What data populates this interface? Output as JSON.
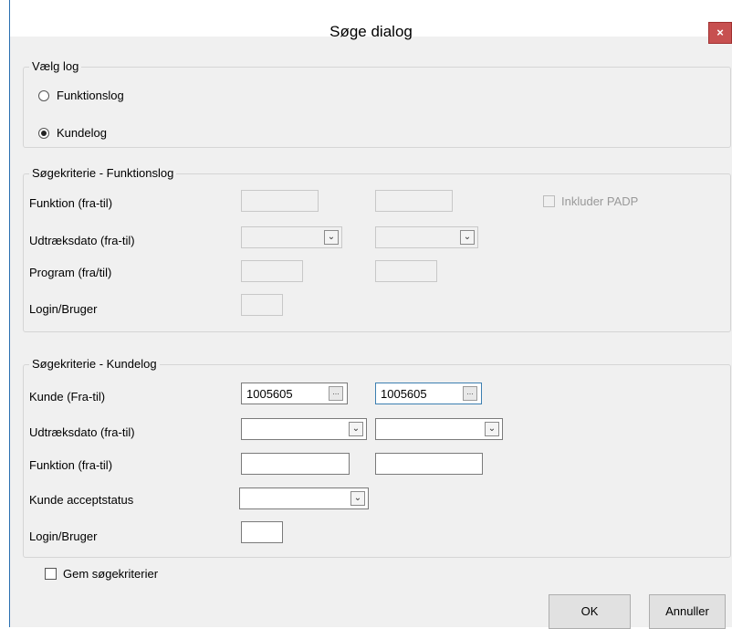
{
  "window": {
    "title": "Søge dialog",
    "close_symbol": "×"
  },
  "vaelg_log": {
    "title": "Vælg log",
    "options": [
      {
        "label": "Funktionslog",
        "selected": false
      },
      {
        "label": "Kundelog",
        "selected": true
      }
    ]
  },
  "funktionslog": {
    "title": "Søgekriterie - Funktionslog",
    "funktion_label": "Funktion (fra-til)",
    "udtraeksdato_label": "Udtræksdato (fra-til)",
    "program_label": "Program (fra/til)",
    "login_label": "Login/Bruger",
    "inkluder_padp_label": "Inkluder PADP",
    "inkluder_padp_checked": false
  },
  "kundelog": {
    "title": "Søgekriterie - Kundelog",
    "kunde_label": "Kunde (Fra-til)",
    "kunde_fra": "1005605",
    "kunde_til": "1005605",
    "udtraeksdato_label": "Udtræksdato (fra-til)",
    "funktion_label": "Funktion (fra-til)",
    "acceptstatus_label": "Kunde acceptstatus",
    "login_label": "Login/Bruger"
  },
  "gem": {
    "label": "Gem søgekriterier",
    "checked": false
  },
  "buttons": {
    "ok": "OK",
    "cancel": "Annuller"
  },
  "icons": {
    "dropdown": "chevron-down-icon",
    "ellipsis": "ellipsis-icon",
    "close": "close-icon"
  },
  "colors": {
    "close_bg": "#c75050",
    "window_border": "#2a6fb0"
  }
}
